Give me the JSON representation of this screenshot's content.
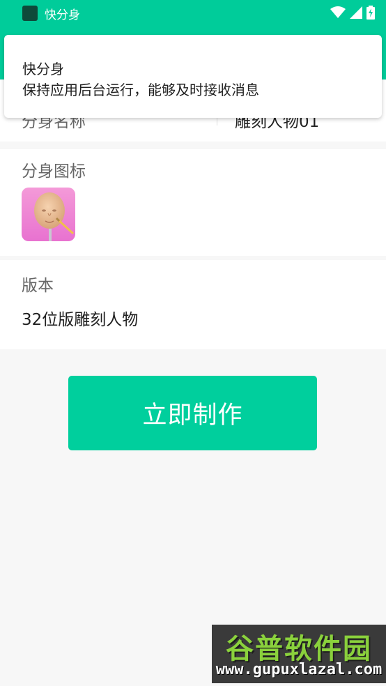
{
  "status_bar": {
    "app_name": "快分身"
  },
  "notification": {
    "title": "快分身",
    "text": "保持应用后台运行，能够及时接收消息"
  },
  "form": {
    "name_label": "分身名称",
    "name_value": "雕刻人物01",
    "icon_label": "分身图标",
    "version_label": "版本",
    "version_value": "32位版雕刻人物"
  },
  "action": {
    "make_label": "立即制作"
  },
  "watermark": {
    "title": "谷普软件园",
    "url": "www.gupuxlazal.com"
  },
  "colors": {
    "accent": "#00cc9a",
    "background": "#f7f7f7"
  }
}
